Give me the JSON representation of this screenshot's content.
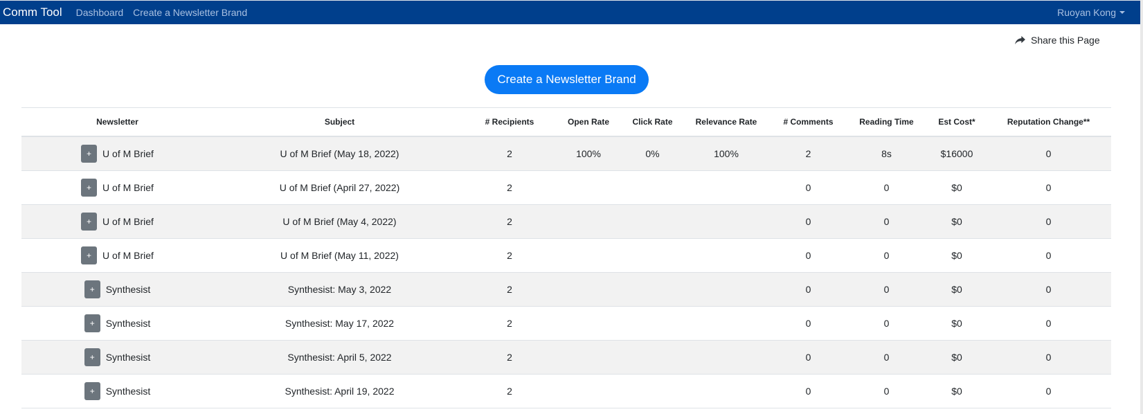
{
  "navbar": {
    "brand": "Comm Tool",
    "links": [
      "Dashboard",
      "Create a Newsletter Brand"
    ],
    "user": "Ruoyan Kong"
  },
  "share_label": "Share this Page",
  "create_button_label": "Create a Newsletter Brand",
  "table": {
    "headers": [
      "Newsletter",
      "Subject",
      "# Recipients",
      "Open Rate",
      "Click Rate",
      "Relevance Rate",
      "# Comments",
      "Reading Time",
      "Est Cost*",
      "Reputation Change**"
    ],
    "expand_label": "+",
    "rows": [
      {
        "newsletter": "U of M Brief",
        "subject": "U of M Brief (May 18, 2022)",
        "recipients": "2",
        "open_rate": "100%",
        "click_rate": "0%",
        "relevance_rate": "100%",
        "comments": "2",
        "reading_time": "8s",
        "est_cost": "$16000",
        "reputation_change": "0"
      },
      {
        "newsletter": "U of M Brief",
        "subject": "U of M Brief (April 27, 2022)",
        "recipients": "2",
        "open_rate": "",
        "click_rate": "",
        "relevance_rate": "",
        "comments": "0",
        "reading_time": "0",
        "est_cost": "$0",
        "reputation_change": "0"
      },
      {
        "newsletter": "U of M Brief",
        "subject": "U of M Brief (May 4, 2022)",
        "recipients": "2",
        "open_rate": "",
        "click_rate": "",
        "relevance_rate": "",
        "comments": "0",
        "reading_time": "0",
        "est_cost": "$0",
        "reputation_change": "0"
      },
      {
        "newsletter": "U of M Brief",
        "subject": "U of M Brief (May 11, 2022)",
        "recipients": "2",
        "open_rate": "",
        "click_rate": "",
        "relevance_rate": "",
        "comments": "0",
        "reading_time": "0",
        "est_cost": "$0",
        "reputation_change": "0"
      },
      {
        "newsletter": "Synthesist",
        "subject": "Synthesist: May 3, 2022",
        "recipients": "2",
        "open_rate": "",
        "click_rate": "",
        "relevance_rate": "",
        "comments": "0",
        "reading_time": "0",
        "est_cost": "$0",
        "reputation_change": "0"
      },
      {
        "newsletter": "Synthesist",
        "subject": "Synthesist: May 17, 2022",
        "recipients": "2",
        "open_rate": "",
        "click_rate": "",
        "relevance_rate": "",
        "comments": "0",
        "reading_time": "0",
        "est_cost": "$0",
        "reputation_change": "0"
      },
      {
        "newsletter": "Synthesist",
        "subject": "Synthesist: April 5, 2022",
        "recipients": "2",
        "open_rate": "",
        "click_rate": "",
        "relevance_rate": "",
        "comments": "0",
        "reading_time": "0",
        "est_cost": "$0",
        "reputation_change": "0"
      },
      {
        "newsletter": "Synthesist",
        "subject": "Synthesist: April 19, 2022",
        "recipients": "2",
        "open_rate": "",
        "click_rate": "",
        "relevance_rate": "",
        "comments": "0",
        "reading_time": "0",
        "est_cost": "$0",
        "reputation_change": "0"
      }
    ]
  },
  "colors": {
    "navbar_bg": "#003f8c",
    "primary_button": "#0a7af5",
    "expand_button": "#6c757d",
    "striped_row": "#f2f2f2"
  },
  "icons": {
    "share": "share-arrow-icon",
    "user_menu": "caret-down-icon"
  }
}
